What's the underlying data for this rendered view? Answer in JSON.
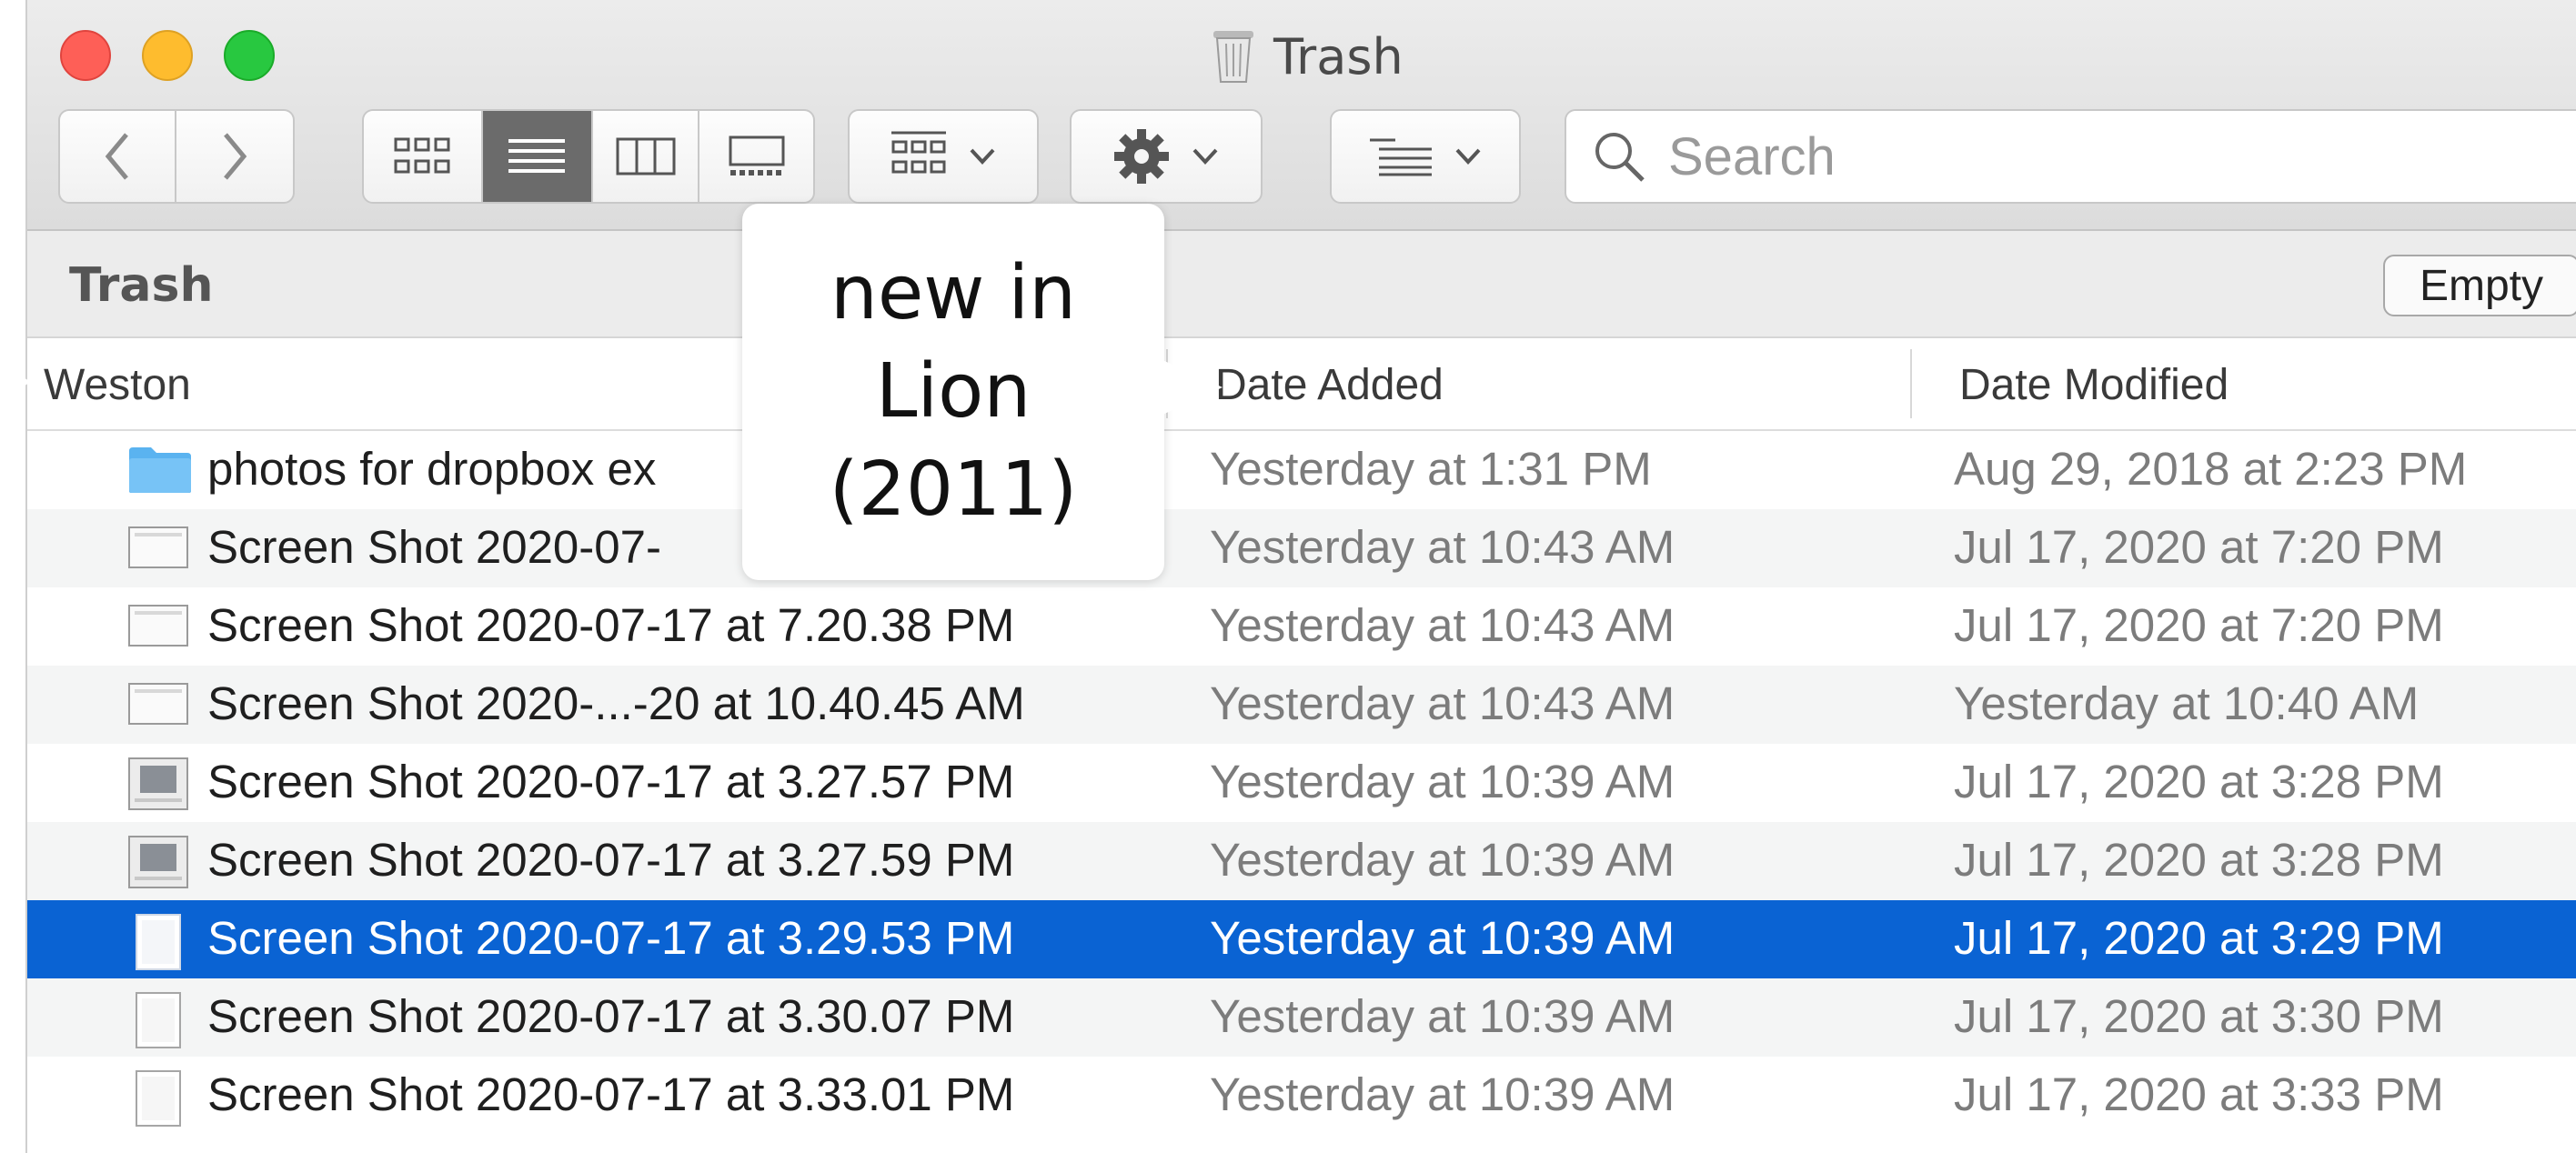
{
  "window": {
    "title": "Trash"
  },
  "toolbar": {
    "back_icon": "chevron-left-icon",
    "forward_icon": "chevron-right-icon",
    "views": [
      "icon-view-icon",
      "list-view-icon",
      "column-view-icon",
      "gallery-view-icon"
    ],
    "active_view": "list-view-icon",
    "group_icon": "group-grid-icon",
    "action_icon": "gear-icon",
    "sort_icon": "sort-lines-icon",
    "search_placeholder": "Search"
  },
  "pathbar": {
    "title": "Trash",
    "empty_label": "Empty"
  },
  "columns": {
    "name": "Weston",
    "date_added": "Date Added",
    "date_modified": "Date Modified"
  },
  "callout": {
    "line1": "new in",
    "line2": "Lion",
    "line3": "(2011)"
  },
  "rows": [
    {
      "name": "photos for dropbox ex",
      "added": "Yesterday at 1:31 PM",
      "modified": "Aug 29, 2018 at 2:23 PM",
      "icon": "folder-icon"
    },
    {
      "name": "Screen Shot 2020-07-",
      "added": "Yesterday at 10:43 AM",
      "modified": "Jul 17, 2020 at 7:20 PM",
      "icon": "screenshot-file-icon"
    },
    {
      "name": "Screen Shot 2020-07-17 at 7.20.38 PM",
      "added": "Yesterday at 10:43 AM",
      "modified": "Jul 17, 2020 at 7:20 PM",
      "icon": "screenshot-file-icon"
    },
    {
      "name": "Screen Shot 2020-...-20 at 10.40.45 AM",
      "added": "Yesterday at 10:43 AM",
      "modified": "Yesterday at 10:40 AM",
      "icon": "screenshot-file-icon"
    },
    {
      "name": "Screen Shot 2020-07-17 at 3.27.57 PM",
      "added": "Yesterday at 10:39 AM",
      "modified": "Jul 17, 2020 at 3:28 PM",
      "icon": "screenshot-file-icon"
    },
    {
      "name": "Screen Shot 2020-07-17 at 3.27.59 PM",
      "added": "Yesterday at 10:39 AM",
      "modified": "Jul 17, 2020 at 3:28 PM",
      "icon": "screenshot-file-icon"
    },
    {
      "name": "Screen Shot 2020-07-17 at 3.29.53 PM",
      "added": "Yesterday at 10:39 AM",
      "modified": "Jul 17, 2020 at 3:29 PM",
      "icon": "image-file-icon",
      "selected": true
    },
    {
      "name": "Screen Shot 2020-07-17 at 3.30.07 PM",
      "added": "Yesterday at 10:39 AM",
      "modified": "Jul 17, 2020 at 3:30 PM",
      "icon": "image-file-icon"
    },
    {
      "name": "Screen Shot 2020-07-17 at 3.33.01 PM",
      "added": "Yesterday at 10:39 AM",
      "modified": "Jul 17, 2020 at 3:33 PM",
      "icon": "image-file-icon"
    }
  ],
  "colors": {
    "selection": "#0a63d3",
    "folder": "#5ab3f0",
    "close": "#fe5f57",
    "minimize": "#febc2e",
    "zoom": "#28c840"
  }
}
